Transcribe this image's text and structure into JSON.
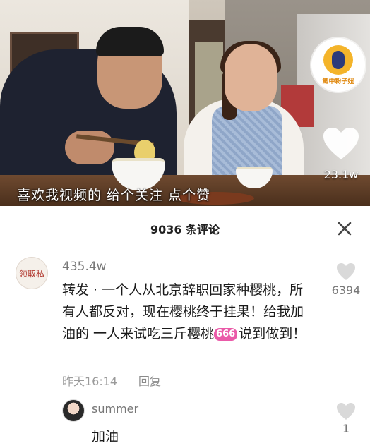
{
  "video": {
    "caption": "喜欢我视频的  给个关注  点个赞",
    "channel_badge_text": "鲫中粉子妞",
    "like_count": "23.1w"
  },
  "comments_panel": {
    "title": "9036 条评论",
    "close_icon": "close-icon",
    "comments": [
      {
        "avatar_text": "领取私",
        "username": "435.4w",
        "text_before_emoji": "转发 · 一个人从北京辞职回家种樱桃，所有人都反对，现在樱桃终于挂果！给我加油的 一人来试吃三斤樱桃",
        "emoji": "666",
        "text_after_emoji": "说到做到！",
        "timestamp": "昨天16:14",
        "reply_label": "回复",
        "likes": "6394"
      },
      {
        "username": "summer",
        "text": "加油",
        "likes": "1"
      }
    ]
  },
  "colors": {
    "sheet_bg": "#ffffff",
    "muted_text": "#9a9a9a",
    "like_icon": "#d9d9d9",
    "emoji_pink": "#ea5aa8"
  }
}
